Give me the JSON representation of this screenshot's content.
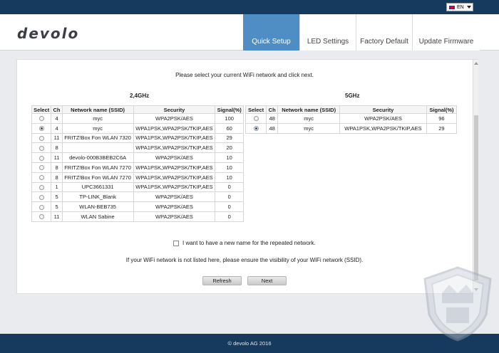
{
  "language": {
    "code": "EN"
  },
  "brand": {
    "logo": "devolo"
  },
  "nav": {
    "tabs": [
      {
        "label": "Quick Setup",
        "active": true
      },
      {
        "label": "LED Settings",
        "active": false
      },
      {
        "label": "Factory Default",
        "active": false
      },
      {
        "label": "Update Firmware",
        "active": false
      }
    ]
  },
  "main": {
    "instruction": "Please select your current WiFi network and click next.",
    "band24": {
      "title": "2,4GHz",
      "headers": [
        "Select",
        "Ch",
        "Network name (SSID)",
        "Security",
        "Signal(%)"
      ],
      "rows": [
        {
          "selected": false,
          "ch": "4",
          "ssid": "myc",
          "security": "WPA2PSK/AES",
          "signal": "100"
        },
        {
          "selected": true,
          "ch": "4",
          "ssid": "myc",
          "security": "WPA1PSK,WPA2PSK/TKIP,AES",
          "signal": "60"
        },
        {
          "selected": false,
          "ch": "11",
          "ssid": "FRITZ!Box Fon WLAN 7320",
          "security": "WPA1PSK,WPA2PSK/TKIP,AES",
          "signal": "29"
        },
        {
          "selected": false,
          "ch": "8",
          "ssid": "",
          "security": "WPA1PSK,WPA2PSK/TKIP,AES",
          "signal": "20"
        },
        {
          "selected": false,
          "ch": "11",
          "ssid": "devolo-000B3BEB2C6A",
          "security": "WPA2PSK/AES",
          "signal": "10"
        },
        {
          "selected": false,
          "ch": "8",
          "ssid": "FRITZ!Box Fon WLAN 7270",
          "security": "WPA1PSK,WPA2PSK/TKIP,AES",
          "signal": "10"
        },
        {
          "selected": false,
          "ch": "8",
          "ssid": "FRITZ!Box Fon WLAN 7270",
          "security": "WPA1PSK,WPA2PSK/TKIP,AES",
          "signal": "10"
        },
        {
          "selected": false,
          "ch": "1",
          "ssid": "UPC3661331",
          "security": "WPA1PSK,WPA2PSK/TKIP,AES",
          "signal": "0"
        },
        {
          "selected": false,
          "ch": "5",
          "ssid": "TP-LINK_Blank",
          "security": "WPA2PSK/AES",
          "signal": "0"
        },
        {
          "selected": false,
          "ch": "5",
          "ssid": "WLAN-BEB735",
          "security": "WPA2PSK/AES",
          "signal": "0"
        },
        {
          "selected": false,
          "ch": "11",
          "ssid": "WLAN Sabine",
          "security": "WPA2PSK/AES",
          "signal": "0"
        }
      ]
    },
    "band5": {
      "title": "5GHz",
      "headers": [
        "Select",
        "Ch",
        "Network name (SSID)",
        "Security",
        "Signal(%)"
      ],
      "rows": [
        {
          "selected": false,
          "ch": "48",
          "ssid": "myc",
          "security": "WPA2PSK/AES",
          "signal": "96"
        },
        {
          "selected": true,
          "ch": "48",
          "ssid": "myc",
          "security": "WPA1PSK,WPA2PSK/TKIP,AES",
          "signal": "29"
        }
      ]
    },
    "rename_checkbox": {
      "label": "I want to have a new name for the repeated network.",
      "checked": false
    },
    "notice": "If your WiFi network is not listed here, please ensure the visibility of your WiFi network (SSID).",
    "refresh_label": "Refresh",
    "next_label": "Next"
  },
  "footer": {
    "copyright": "© devolo AG 2016"
  },
  "colors": {
    "topbar": "#163a5e",
    "active_tab": "#4f8ec4",
    "background": "#e9ebee"
  }
}
